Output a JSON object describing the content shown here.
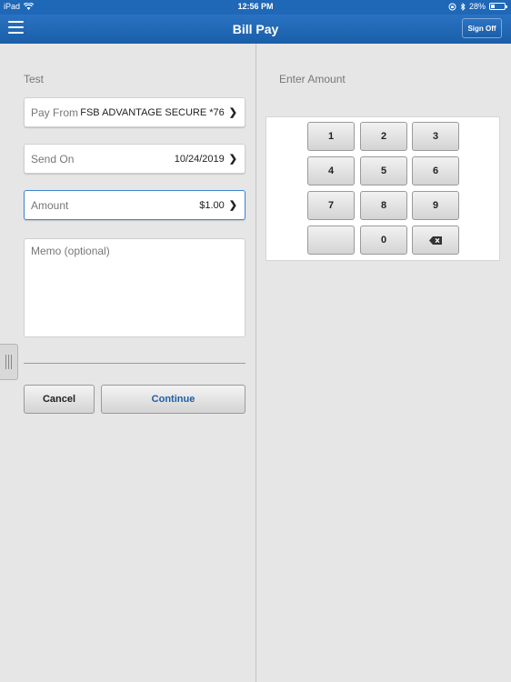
{
  "status_bar": {
    "device": "iPad",
    "time": "12:56 PM",
    "battery": "28%",
    "battery_level": 0.28
  },
  "nav": {
    "title": "Bill Pay",
    "sign_off": "Sign Off"
  },
  "form": {
    "payee": "Test",
    "pay_from": {
      "label": "Pay From",
      "value": "FSB ADVANTAGE SECURE *76"
    },
    "send_on": {
      "label": "Send On",
      "value": "10/24/2019"
    },
    "amount": {
      "label": "Amount",
      "value": "$1.00"
    },
    "memo_placeholder": "Memo (optional)",
    "cancel": "Cancel",
    "continue": "Continue"
  },
  "keypad": {
    "title": "Enter Amount",
    "keys": [
      "1",
      "2",
      "3",
      "4",
      "5",
      "6",
      "7",
      "8",
      "9",
      "",
      "0"
    ]
  },
  "colors": {
    "nav_blue": "#1f67b7",
    "accent": "#1c5ea7",
    "active_border": "#3f86cf"
  }
}
